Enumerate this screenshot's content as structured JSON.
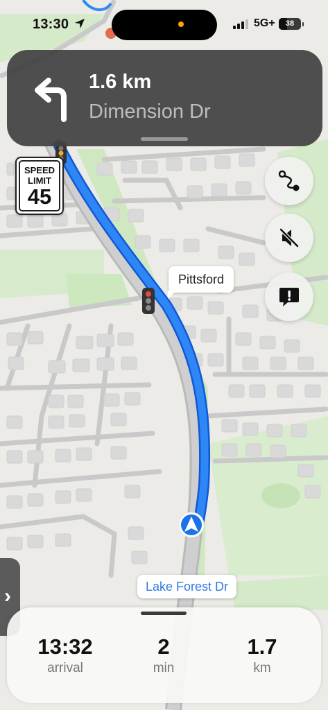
{
  "status_bar": {
    "time": "13:30",
    "network": "5G+",
    "battery": "38",
    "battery_percent": 38
  },
  "banner": {
    "distance": "1.6 km",
    "street": "Dimension Dr",
    "maneuver": "turn-left-icon"
  },
  "speed_limit": {
    "label_line1": "SPEED",
    "label_line2": "LIMIT",
    "value": "45"
  },
  "buttons": {
    "route": "route-icon",
    "mute": "speaker-muted-icon",
    "report": "report-incident-icon"
  },
  "map": {
    "place_label": "Pittsford",
    "road_label": "Lake Forest Dr"
  },
  "colors": {
    "route": "#1f7cf6",
    "banner": "#424242",
    "label_text": "#2f7ae5"
  },
  "trip": {
    "arrival": {
      "value": "13:32",
      "unit": "arrival"
    },
    "duration": {
      "value": "2",
      "unit": "min"
    },
    "distance": {
      "value": "1.7",
      "unit": "km"
    }
  }
}
